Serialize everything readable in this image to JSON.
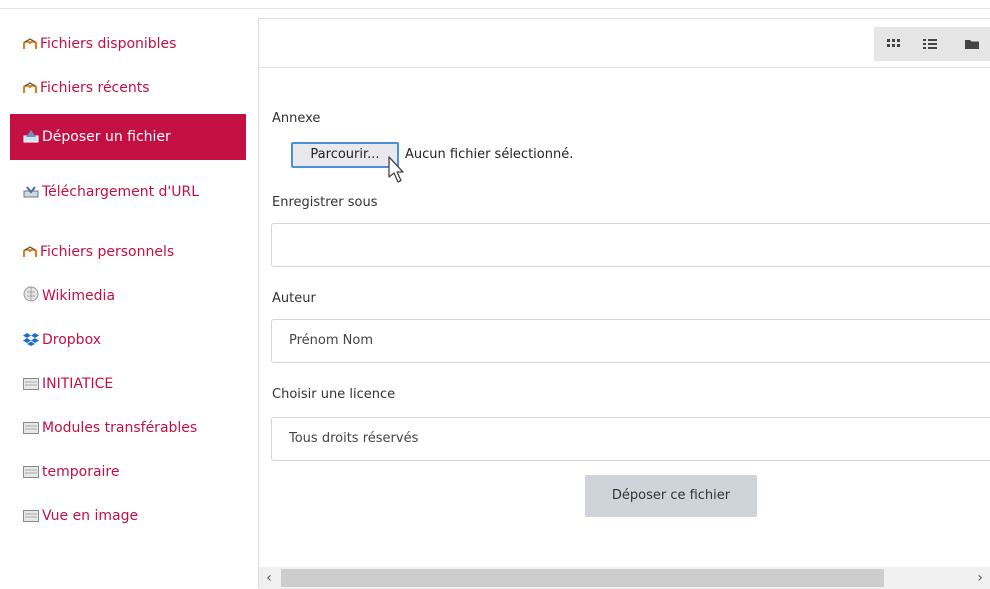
{
  "sidebar": {
    "items": [
      {
        "label": "Fichiers disponibles",
        "icon": "moodle-icon"
      },
      {
        "label": "Fichiers récents",
        "icon": "moodle-icon"
      },
      {
        "label": "Déposer un fichier",
        "icon": "upload-icon",
        "active": true
      },
      {
        "label": "Téléchargement d'URL",
        "icon": "url-download-icon"
      },
      {
        "label": "Fichiers personnels",
        "icon": "moodle-icon"
      },
      {
        "label": "Wikimedia",
        "icon": "wikimedia-icon"
      },
      {
        "label": "Dropbox",
        "icon": "dropbox-icon"
      },
      {
        "label": "INITIATICE",
        "icon": "repository-icon"
      },
      {
        "label": "Modules transférables",
        "icon": "repository-icon"
      },
      {
        "label": "temporaire",
        "icon": "repository-icon"
      },
      {
        "label": "Vue en image",
        "icon": "repository-icon"
      }
    ]
  },
  "toolbar": {
    "view_icons": [
      "grid-view-icon",
      "list-view-icon",
      "folder-view-icon"
    ]
  },
  "form": {
    "attachment_label": "Annexe",
    "browse_label": "Parcourir...",
    "no_file_text": "Aucun fichier sélectionné.",
    "save_as_label": "Enregistrer sous",
    "save_as_value": "",
    "author_label": "Auteur",
    "author_value": "Prénom Nom",
    "license_label": "Choisir une licence",
    "license_value": "Tous droits réservés",
    "submit_label": "Déposer ce fichier"
  },
  "colors": {
    "accent": "#c40f43",
    "button_grey": "#ced4da"
  }
}
